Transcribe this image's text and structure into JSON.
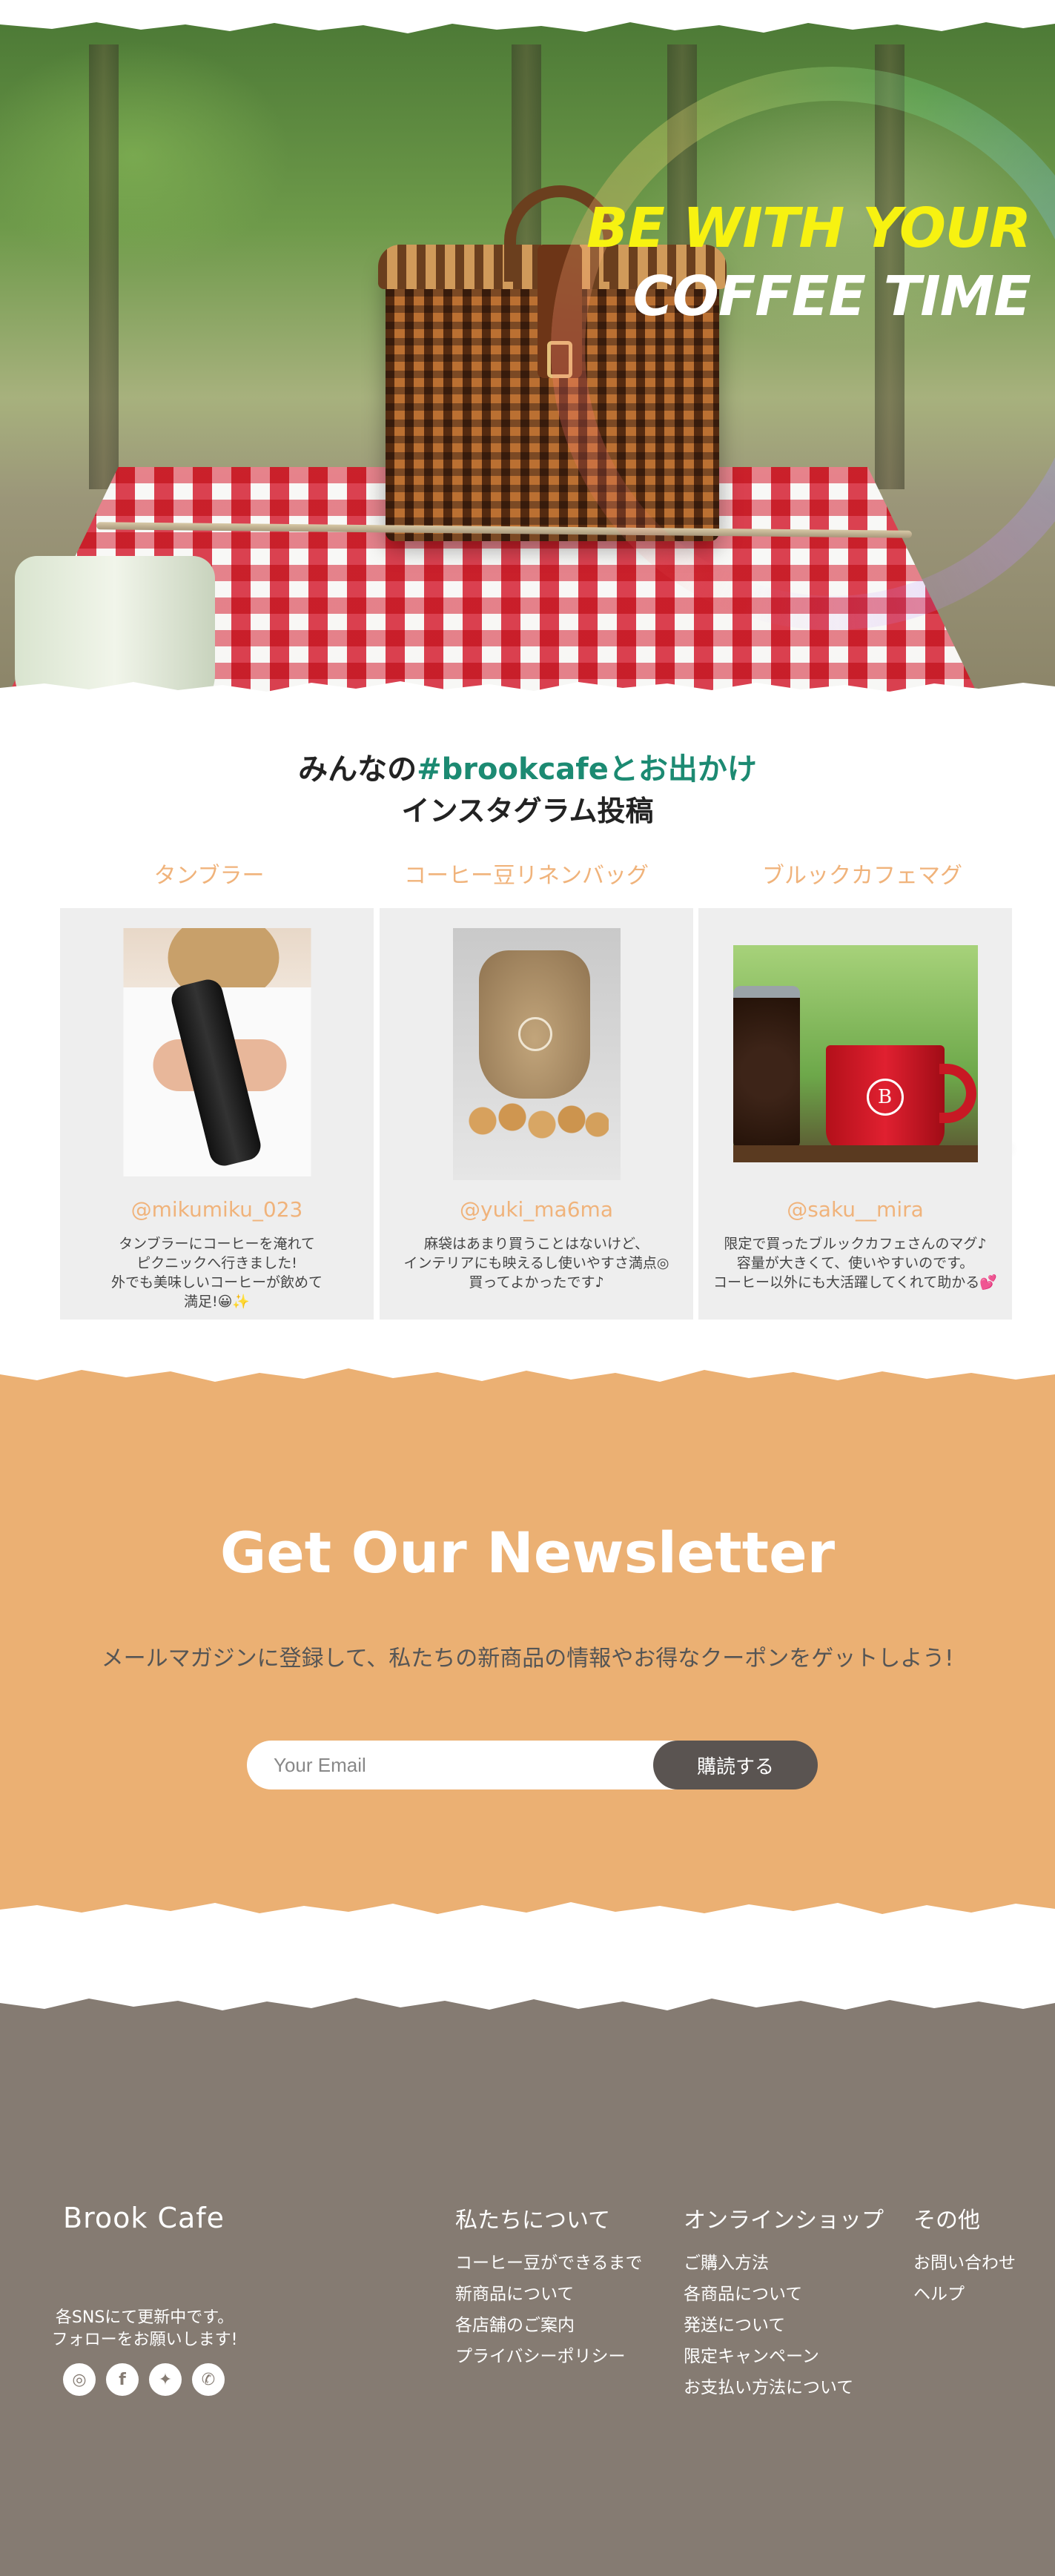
{
  "hero": {
    "title_line1": "BE WITH YOUR",
    "title_line2": "COFFEE TIME"
  },
  "insta": {
    "heading_prefix": "みんなの",
    "heading_hashtag": "#brookcafeとお出かけ",
    "heading_sub": "インスタグラム投稿",
    "posts": [
      {
        "category": "タンブラー",
        "user": "@mikumiku_023",
        "text_lines": [
          "タンブラーにコーヒーを淹れて",
          "ピクニックへ行きました!",
          "外でも美味しいコーヒーが飲めて",
          "満足!😀✨"
        ]
      },
      {
        "category": "コーヒー豆リネンバッグ",
        "user": "@yuki_ma6ma",
        "text_lines": [
          "麻袋はあまり買うことはないけど、",
          "インテリアにも映えるし使いやすさ満点◎",
          "買ってよかったです♪"
        ]
      },
      {
        "category": "ブルックカフェマグ",
        "user": "@saku__mira",
        "text_lines": [
          "限定で買ったブルックカフェさんのマグ♪",
          "容量が大きくて、使いやすいのです。",
          "コーヒー以外にも大活躍してくれて助かる💕"
        ]
      }
    ]
  },
  "newsletter": {
    "title": "Get Our Newsletter",
    "description": "メールマガジンに登録して、私たちの新商品の情報やお得なクーポンをゲットしよう!",
    "email_placeholder": "Your Email",
    "subscribe_label": "購読する"
  },
  "footer": {
    "brand": "Brook Cafe",
    "sns_note_line1": "各SNSにて更新中です。",
    "sns_note_line2": "フォローをお願いします!",
    "sns": [
      {
        "icon": "instagram-icon",
        "glyph": "◎"
      },
      {
        "icon": "facebook-icon",
        "glyph": "f"
      },
      {
        "icon": "twitter-icon",
        "glyph": "✦"
      },
      {
        "icon": "whatsapp-icon",
        "glyph": "✆"
      }
    ],
    "columns": [
      {
        "heading": "私たちについて",
        "links": [
          "コーヒー豆ができるまで",
          "新商品について",
          "各店舗のご案内",
          "プライバシーポリシー"
        ]
      },
      {
        "heading": "オンラインショップ",
        "links": [
          "ご購入方法",
          "各商品について",
          "発送について",
          "限定キャンペーン",
          "お支払い方法について"
        ]
      },
      {
        "heading": "その他",
        "links": [
          "お問い合わせ",
          "ヘルプ"
        ]
      }
    ]
  },
  "colors": {
    "accent_orange": "#ebb073",
    "footer_brown": "#857b72",
    "hashtag_green": "#1c8a72",
    "title_yellow": "#f7f211"
  }
}
